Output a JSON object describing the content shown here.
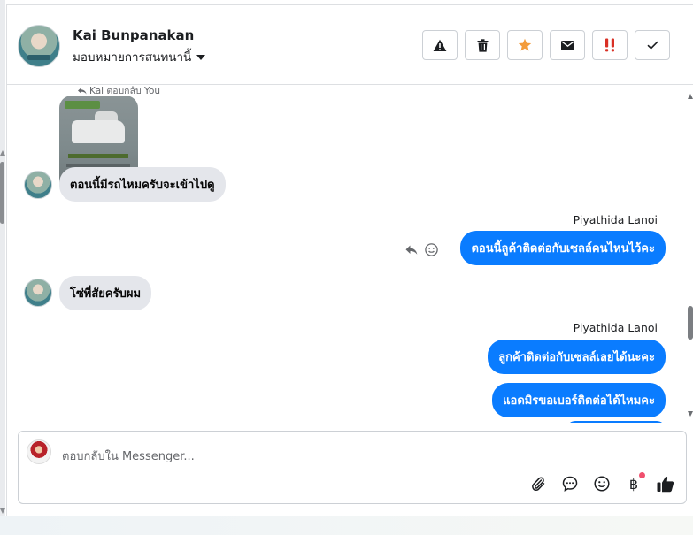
{
  "header": {
    "contact_name": "Kai Bunpanakan",
    "assign_label": "มอบหมายการสนทนานี้",
    "actions": [
      {
        "name": "warning",
        "icon": "warning-icon"
      },
      {
        "name": "delete",
        "icon": "trash-icon"
      },
      {
        "name": "star",
        "icon": "star-icon",
        "color": "#f39c3b"
      },
      {
        "name": "mail",
        "icon": "envelope-icon"
      },
      {
        "name": "important",
        "icon": "double-exclamation-icon",
        "color": "#d93025"
      },
      {
        "name": "done",
        "icon": "checkmark-icon"
      }
    ]
  },
  "thread": {
    "reply_note": "Kai ตอบกลับ You",
    "messages": [
      {
        "from": "Kai Bunpanakan",
        "direction": "in",
        "type": "image"
      },
      {
        "from": "Kai Bunpanakan",
        "direction": "in",
        "text": "ตอนนี้มีรถไหมครับจะเข้าไปดู"
      },
      {
        "from": "Piyathida Lanoi",
        "direction": "out",
        "sender_label": "Piyathida Lanoi",
        "text": "ตอนนี้ลูค้าติดต่อกับเซลล์คนไหนไว้คะ"
      },
      {
        "from": "Kai Bunpanakan",
        "direction": "in",
        "text": "โซ่พี่สัยครับผม"
      },
      {
        "from": "Piyathida Lanoi",
        "direction": "out",
        "sender_label": "Piyathida Lanoi",
        "text": "ลูกค้าติดต่อกับเซลล์เลยได้นะคะ"
      },
      {
        "from": "Piyathida Lanoi",
        "direction": "out",
        "text": "แอดมิรขอเบอร์ติดต่อได้ไหมคะ"
      }
    ]
  },
  "composer": {
    "placeholder": "ตอบกลับใน Messenger...",
    "tools": [
      "paperclip-icon",
      "chat-bubble-icon",
      "smiley-icon",
      "baht-icon",
      "thumbs-up-icon"
    ],
    "baht_symbol": "฿",
    "accent_color": "#0a7cff"
  }
}
